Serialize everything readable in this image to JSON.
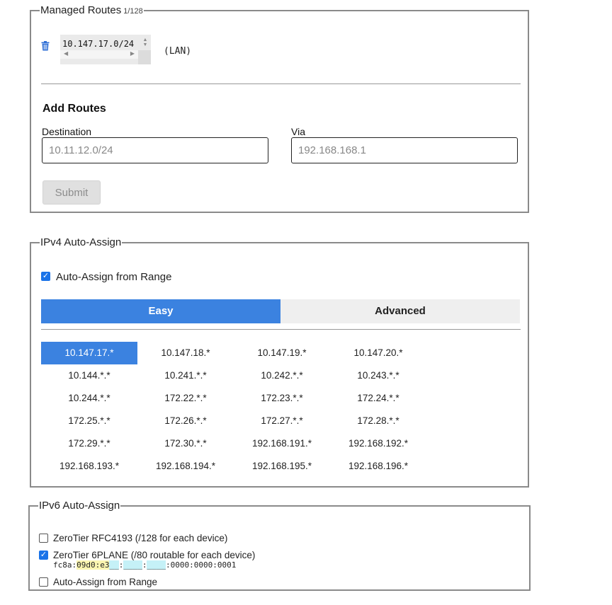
{
  "managed_routes": {
    "legend": "Managed Routes",
    "count": "1/128",
    "routes": [
      {
        "target": "10.147.17.0/24",
        "note": "(LAN)"
      }
    ]
  },
  "add_routes": {
    "title": "Add Routes",
    "destination_label": "Destination",
    "destination_placeholder": "10.11.12.0/24",
    "via_label": "Via",
    "via_placeholder": "192.168.168.1",
    "submit_label": "Submit"
  },
  "ipv4": {
    "legend": "IPv4 Auto-Assign",
    "auto_assign_label": "Auto-Assign from Range",
    "auto_assign_checked": true,
    "tabs": [
      {
        "label": "Easy",
        "active": true
      },
      {
        "label": "Advanced",
        "active": false
      }
    ],
    "ranges": [
      "10.147.17.*",
      "10.147.18.*",
      "10.147.19.*",
      "10.147.20.*",
      "10.144.*.*",
      "10.241.*.*",
      "10.242.*.*",
      "10.243.*.*",
      "10.244.*.*",
      "172.22.*.*",
      "172.23.*.*",
      "172.24.*.*",
      "172.25.*.*",
      "172.26.*.*",
      "172.27.*.*",
      "172.28.*.*",
      "172.29.*.*",
      "172.30.*.*",
      "192.168.191.*",
      "192.168.192.*",
      "192.168.193.*",
      "192.168.194.*",
      "192.168.195.*",
      "192.168.196.*"
    ],
    "selected_range": "10.147.17.*"
  },
  "ipv6": {
    "legend": "IPv6 Auto-Assign",
    "options": [
      {
        "label": "ZeroTier RFC4193 (/128 for each device)",
        "checked": false
      },
      {
        "label": "ZeroTier 6PLANE (/80 routable for each device)",
        "checked": true
      },
      {
        "label": "Auto-Assign from Range",
        "checked": false
      }
    ],
    "sixplane_address": {
      "prefix": "fc8a:",
      "net": "09d0:e3",
      "blank1": "__",
      "sep1": ":",
      "blank2": "____",
      "sep2": ":",
      "blank3": "____",
      "suffix": ":0000:0000:0001"
    }
  },
  "colors": {
    "accent": "#3b82e0",
    "checkbox": "#1a73e8",
    "trash_icon": "#2f6fd6"
  }
}
